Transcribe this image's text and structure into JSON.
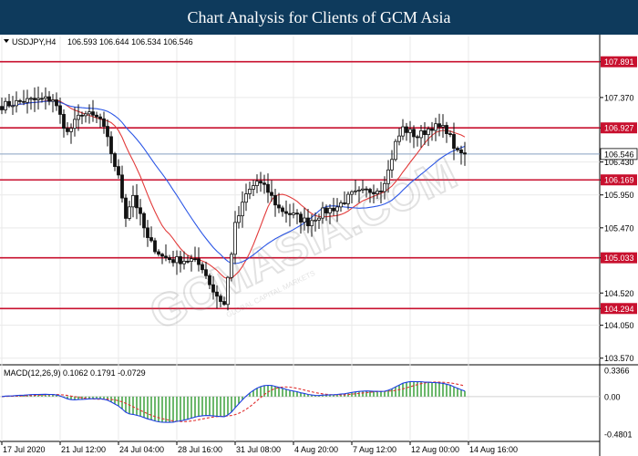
{
  "banner": {
    "title": "Chart Analysis for Clients of GCM Asia"
  },
  "watermark": {
    "text": "GCMASIA.COM",
    "subtext": "GLOBAL CAPITAL MARKETS"
  },
  "colors": {
    "banner_bg": "#0e3a5c",
    "level_line": "#c8102e",
    "price_line": "#8aa4c4",
    "ma_fast": "#e23b3b",
    "ma_slow": "#2b56e6",
    "macd_line": "#1f3fe0",
    "signal_line": "#e03030",
    "histogram": "#2e9a2e",
    "candles": "#111111",
    "grid": "#e9e9e9"
  },
  "chart_data": [
    {
      "type": "candlestick",
      "symbol_label": "USDJPY,H4",
      "ohlc_label": "106.593 106.644 106.534 106.546",
      "current_price": 106.546,
      "ylim": [
        103.5,
        108.1
      ],
      "y_ticks": [
        "107.891",
        "107.370",
        "106.927",
        "106.546",
        "106.430",
        "106.169",
        "105.950",
        "105.470",
        "105.033",
        "104.520",
        "104.294",
        "104.050",
        "103.570"
      ],
      "y_tick_values": [
        107.891,
        107.37,
        106.927,
        106.546,
        106.43,
        106.169,
        105.95,
        105.47,
        105.033,
        104.52,
        104.294,
        104.05,
        103.57
      ],
      "highlighted_ticks": [
        "107.891",
        "106.927",
        "106.169",
        "105.033",
        "104.294"
      ],
      "x_tick_labels": [
        "17 Jul 2020",
        "21 Jul 12:00",
        "24 Jul 04:00",
        "28 Jul 16:00",
        "31 Jul 08:00",
        "4 Aug 20:00",
        "7 Aug 12:00",
        "12 Aug 00:00",
        "14 Aug 16:00"
      ],
      "x_tick_index": [
        0,
        16,
        32,
        48,
        64,
        80,
        96,
        112,
        128
      ],
      "levels": [
        107.891,
        106.927,
        106.169,
        105.033,
        104.294
      ],
      "anchors": [
        [
          0,
          107.25
        ],
        [
          6,
          107.32
        ],
        [
          14,
          107.35
        ],
        [
          18,
          106.85
        ],
        [
          22,
          107.15
        ],
        [
          27,
          107.05
        ],
        [
          29,
          106.75
        ],
        [
          32,
          106.2
        ],
        [
          34,
          105.65
        ],
        [
          36,
          105.95
        ],
        [
          40,
          105.3
        ],
        [
          44,
          105.05
        ],
        [
          47,
          105.0
        ],
        [
          52,
          105.0
        ],
        [
          55,
          104.9
        ],
        [
          58,
          104.55
        ],
        [
          61,
          104.35
        ],
        [
          64,
          105.5
        ],
        [
          67,
          105.95
        ],
        [
          70,
          106.15
        ],
        [
          73,
          106.0
        ],
        [
          76,
          105.75
        ],
        [
          80,
          105.65
        ],
        [
          84,
          105.55
        ],
        [
          88,
          105.7
        ],
        [
          92,
          105.78
        ],
        [
          96,
          105.95
        ],
        [
          100,
          106.0
        ],
        [
          104,
          106.05
        ],
        [
          106,
          106.3
        ],
        [
          108,
          106.7
        ],
        [
          110,
          106.92
        ],
        [
          114,
          106.8
        ],
        [
          118,
          106.95
        ],
        [
          122,
          106.9
        ],
        [
          125,
          106.55
        ],
        [
          127,
          106.56
        ]
      ]
    },
    {
      "type": "macd",
      "label": "MACD(12,26,9) 0.1062 0.1791 -0.0729",
      "ylim": [
        -0.55,
        0.36
      ],
      "y_ticks": [
        "0.3366",
        "0.00",
        "-0.4801"
      ],
      "y_tick_values": [
        0.3366,
        0.0,
        -0.4801
      ]
    }
  ]
}
